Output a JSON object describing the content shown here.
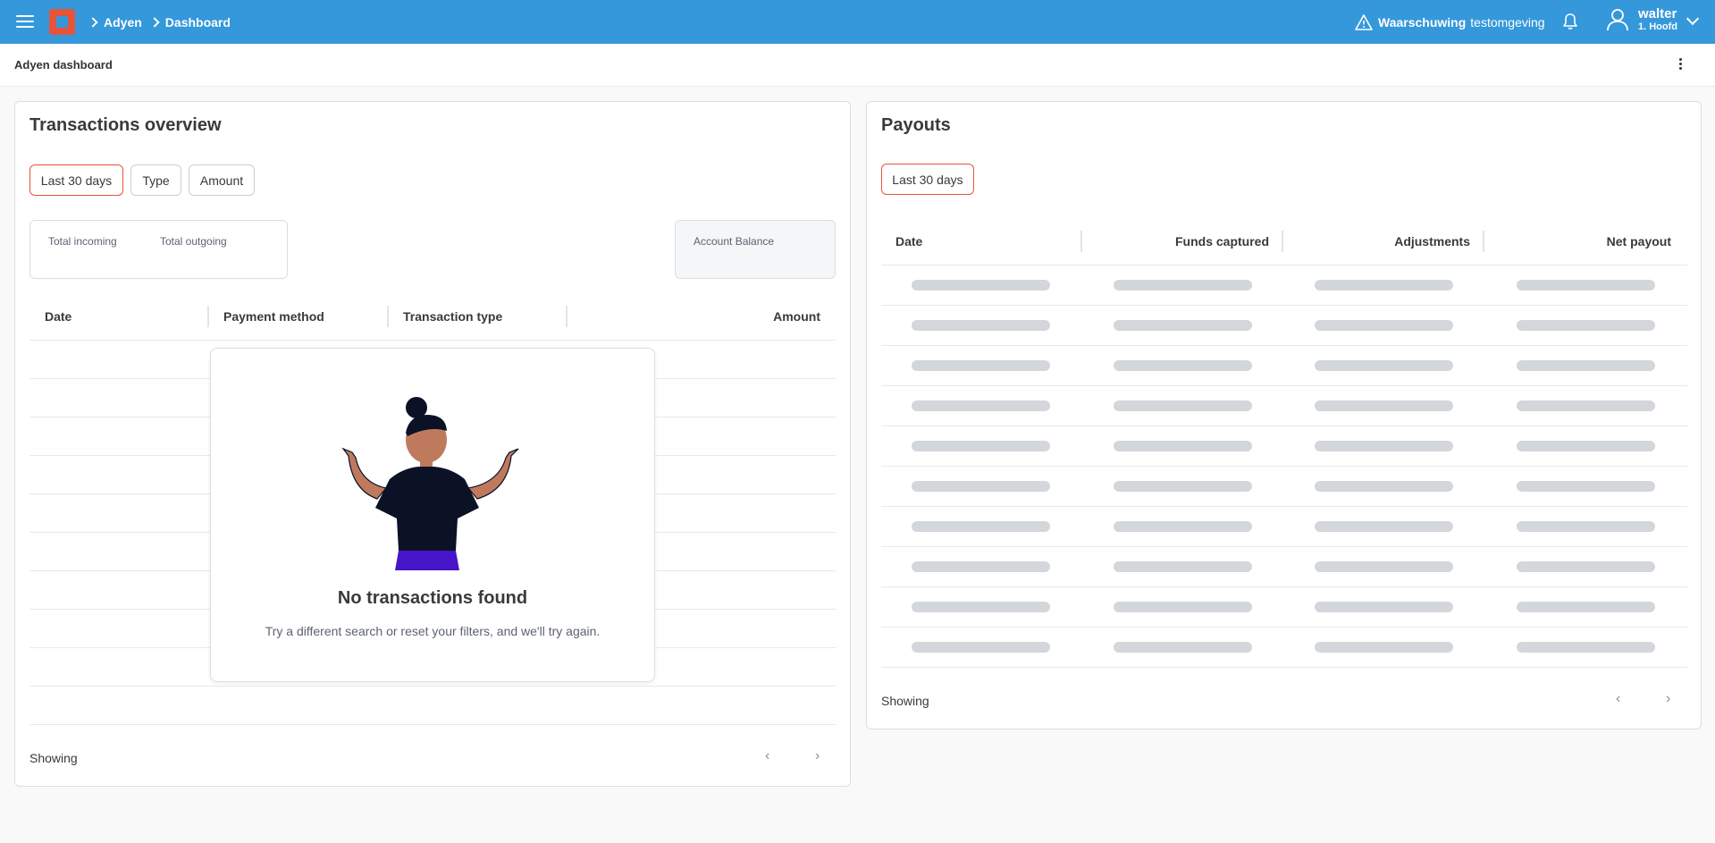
{
  "breadcrumb": [
    "Adyen",
    "Dashboard"
  ],
  "header": {
    "warning_label": "Waarschuwing",
    "warning_env": "testomgeving",
    "user_name": "walter",
    "user_sub": "1. Hoofd"
  },
  "subheader": {
    "title": "Adyen dashboard"
  },
  "transactions": {
    "title": "Transactions overview",
    "filters": [
      "Last 30 days",
      "Type",
      "Amount"
    ],
    "summary": {
      "incoming": "Total incoming",
      "outgoing": "Total outgoing",
      "balance": "Account Balance"
    },
    "columns": [
      "Date",
      "Payment method",
      "Transaction type",
      "Amount"
    ],
    "empty_title": "No transactions found",
    "empty_text": "Try a different search or reset your filters, and we'll try again.",
    "showing": "Showing",
    "prev": "‹",
    "next": "›"
  },
  "payouts": {
    "title": "Payouts",
    "filter": "Last 30 days",
    "columns": [
      "Date",
      "Funds captured",
      "Adjustments",
      "Net payout"
    ],
    "showing": "Showing",
    "prev": "‹",
    "next": "›"
  },
  "colors": {
    "topbar": "#3498db",
    "accent": "#e5543b"
  }
}
